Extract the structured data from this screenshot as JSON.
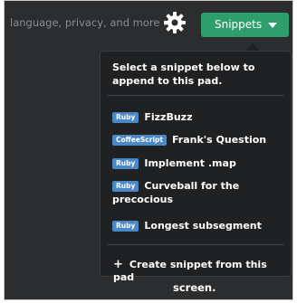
{
  "topbar": {
    "settings_link": "language, privacy, and more >",
    "snippets_button": "Snippets"
  },
  "dropdown": {
    "header": "Select a snippet below to append to this pad.",
    "items": [
      {
        "badge": "Ruby",
        "label": "FizzBuzz"
      },
      {
        "badge": "CoffeeScript",
        "label": "Frank's Question"
      },
      {
        "badge": "Ruby",
        "label": "Implement .map"
      },
      {
        "badge": "Ruby",
        "label": "Curveball for the precocious"
      },
      {
        "badge": "Ruby",
        "label": "Longest subsegment"
      }
    ],
    "create_label": "Create snippet from this pad"
  },
  "background": {
    "screen_text": "screen."
  },
  "colors": {
    "accent_green": "#2e9e6c",
    "badge_blue": "#4a88c7",
    "bg_dark": "#2b2d2f",
    "dropdown_bg": "#1f2123"
  }
}
